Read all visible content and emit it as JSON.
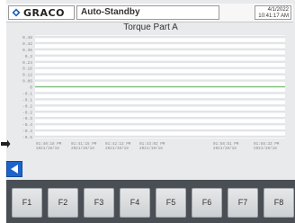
{
  "header": {
    "brand": "GRACO",
    "mode": "Auto-Standby",
    "date": "4/1/2022",
    "time": "10:41:17 AM"
  },
  "chart_data": {
    "type": "line",
    "title": "Torque Part A",
    "yticks": [
      "0.48",
      "0.42",
      "0.36",
      "0.3",
      "0.24",
      "0.18",
      "0.12",
      "0.06",
      "0",
      "-0.1",
      "-0.1",
      "-0.2",
      "-0.2",
      "-0.3",
      "-0.4",
      "-0.4",
      "-0.5"
    ],
    "xticks": [
      {
        "time": "01:40:18 PM",
        "date": "2021/10/18"
      },
      {
        "time": "01:41:15 PM",
        "date": "2021/10/18"
      },
      {
        "time": "01:42:13 PM",
        "date": "2021/10/18"
      },
      {
        "time": "01:43:02 PM",
        "date": "2021/10/18"
      },
      {
        "time": "01:56:51 PM",
        "date": "2021/10/18"
      },
      {
        "time": "01:58:33 PM",
        "date": "2021/10/18"
      }
    ],
    "series": [
      {
        "values": [
          0,
          0,
          0,
          0,
          0,
          0
        ],
        "color": "#7cc47a"
      }
    ],
    "grid": true
  },
  "function_keys": [
    "F1",
    "F2",
    "F3",
    "F4",
    "F5",
    "F6",
    "F7",
    "F8"
  ],
  "colors": {
    "accent_blue": "#1d63c9",
    "brand_blue": "#1b5fb5",
    "series_green": "#7cc47a"
  }
}
